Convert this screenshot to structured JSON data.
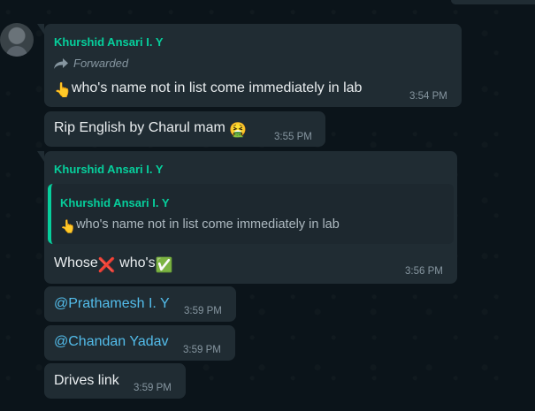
{
  "messages": {
    "m1": {
      "sender": "Khurshid Ansari I. Y",
      "forwarded_label": "Forwarded",
      "emoji": "👆",
      "text": "who's name not in list come immediately in lab",
      "time": "3:54 PM"
    },
    "m2": {
      "text": "Rip English by Charul mam",
      "emoji": "🤮",
      "time": "3:55 PM"
    },
    "m3": {
      "sender": "Khurshid Ansari I. Y",
      "quote": {
        "sender": "Khurshid Ansari I. Y",
        "emoji": "👆",
        "text": "who's name not in list come immediately in lab"
      },
      "text_part1": "Whose",
      "emoji1": "❌",
      "text_part2": " who's",
      "emoji2": "✅",
      "time": "3:56 PM"
    },
    "m4": {
      "mention": "@Prathamesh I. Y",
      "time": "3:59 PM"
    },
    "m5": {
      "mention": "@Chandan Yadav",
      "time": "3:59 PM"
    },
    "m6": {
      "text": "Drives link",
      "time": "3:59 PM"
    }
  },
  "colors": {
    "background": "#0b141a",
    "bubble": "#202c33",
    "sender": "#06cf9c",
    "mention": "#53bdeb",
    "meta": "#8696a0"
  },
  "icons": {
    "avatar": "person-silhouette",
    "forwarded": "forward-arrow-icon"
  }
}
